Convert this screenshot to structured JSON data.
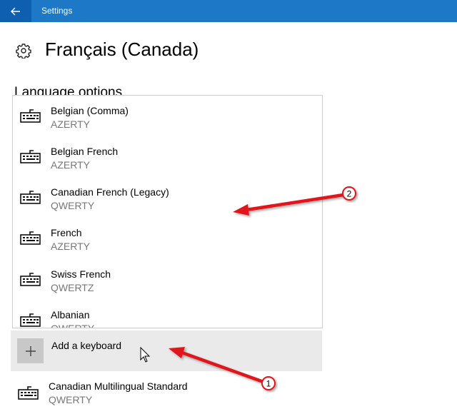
{
  "window": {
    "title": "Settings",
    "accent": "#1e78c8"
  },
  "page": {
    "title": "Français (Canada)",
    "section_title": "Language options"
  },
  "keyboard_dropdown": {
    "items": [
      {
        "name": "Belgian (Comma)",
        "layout": "AZERTY"
      },
      {
        "name": "Belgian French",
        "layout": "AZERTY"
      },
      {
        "name": "Canadian French (Legacy)",
        "layout": "QWERTY"
      },
      {
        "name": "French",
        "layout": "AZERTY"
      },
      {
        "name": "Swiss French",
        "layout": "QWERTZ"
      },
      {
        "name": "Albanian",
        "layout": "QWERTY"
      }
    ]
  },
  "add_keyboard": {
    "label": "Add a keyboard"
  },
  "installed_keyboards": [
    {
      "name": "Canadian Multilingual Standard",
      "layout": "QWERTY"
    }
  ],
  "annotations": {
    "callout_1": "1",
    "callout_2": "2",
    "arrow_color": "#e0191b"
  }
}
